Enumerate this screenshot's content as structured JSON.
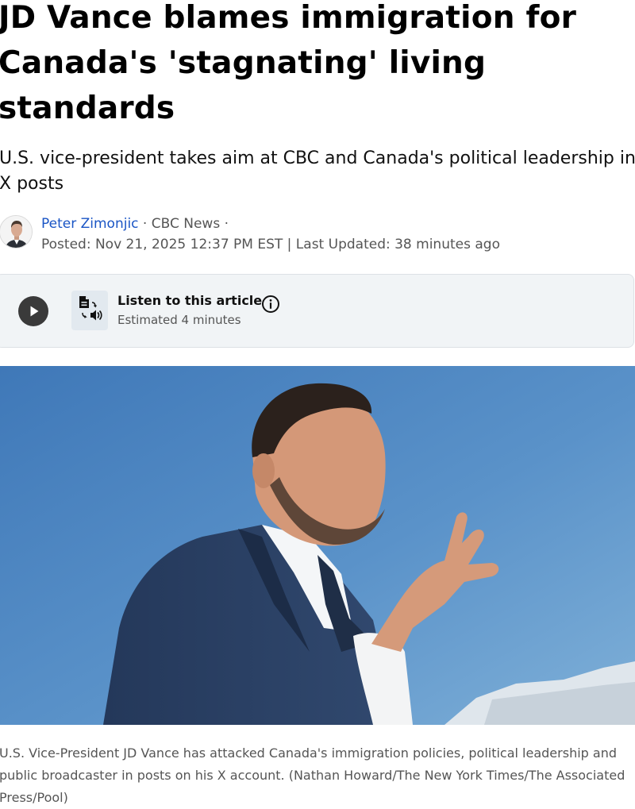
{
  "article": {
    "headline": "JD Vance blames immigration for Canada's 'stagnating' living standards",
    "subhead": "U.S. vice-president takes aim at CBC and Canada's political leadership in X posts"
  },
  "byline": {
    "author": "Peter Zimonjic",
    "separator_1": " · ",
    "outlet": "CBC News",
    "separator_2": " ·",
    "posted": "Posted: Nov 21, 2025 12:37 PM EST | Last Updated: 38 minutes ago"
  },
  "listen": {
    "title": "Listen to this article",
    "estimate": "Estimated 4 minutes",
    "icons": [
      "play-icon",
      "text-to-speech-icon",
      "info-icon"
    ]
  },
  "photo": {
    "caption": "U.S. Vice-President JD Vance has attacked Canada's immigration policies, political leadership and public broadcaster in posts on his X account. (Nathan Howard/The New York Times/The Associated Press/Pool)"
  },
  "colors": {
    "author_link": "#1a55c5",
    "listen_bg": "#f1f4f6",
    "play_button": "#3a3a3a",
    "sky": "#4f86c2",
    "meta_text": "#555555"
  }
}
